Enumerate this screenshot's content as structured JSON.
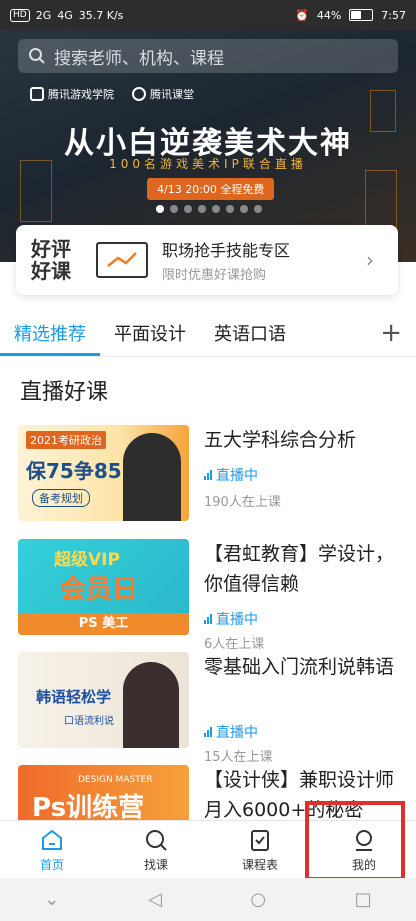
{
  "status_bar": {
    "sim": "HD",
    "net1": "2G",
    "net2": "4G",
    "speed": "35.7 K/s",
    "battery": "44%",
    "time": "7:57"
  },
  "search": {
    "placeholder": "搜索老师、机构、课程"
  },
  "banner": {
    "logo1": "腾讯游戏学院",
    "logo2": "腾讯课堂",
    "headline": "从小白逆袭美术大神",
    "subline": "100名游戏美术IP联合直播",
    "date": "4/13 20:00 全程免费",
    "dots_count": 8,
    "active_dot": 0
  },
  "promo": {
    "badge_line1": "好评",
    "badge_line2": "好课",
    "title": "职场抢手技能专区",
    "subtitle": "限时优惠好课抢购"
  },
  "tabs": [
    "精选推荐",
    "平面设计",
    "英语口语"
  ],
  "tab_add": "+",
  "section_title": "直播好课",
  "courses": [
    {
      "title": "五大学科综合分析",
      "status": "直播中",
      "viewers": "190人在上课",
      "thumb_line1": "2021考研政治",
      "thumb_line2": "保75争85",
      "thumb_line3": "备考规划"
    },
    {
      "title": "【君虹教育】学设计，你值得信赖",
      "status": "直播中",
      "viewers": "6人在上课",
      "thumb_line1": "超级VIP",
      "thumb_line2": "会员日",
      "thumb_line3": "PS 美工"
    },
    {
      "title": "零基础入门流利说韩语",
      "status": "直播中",
      "viewers": "15人在上课",
      "thumb_line1": "韩语轻松学",
      "thumb_line2": "口语流利说",
      "thumb_line3": ""
    },
    {
      "title": "【设计侠】兼职设计师月入6000+的秘密",
      "status": "",
      "viewers": "",
      "thumb_line1": "DESIGN MASTER",
      "thumb_line2": "Ps训练营",
      "thumb_line3": ""
    }
  ],
  "bottom_nav": [
    {
      "label": "首页",
      "icon": "home-icon"
    },
    {
      "label": "找课",
      "icon": "search-icon"
    },
    {
      "label": "课程表",
      "icon": "schedule-icon"
    },
    {
      "label": "我的",
      "icon": "profile-icon"
    }
  ],
  "colors": {
    "accent": "#1e9be8",
    "highlight_box": "#e0302a"
  }
}
